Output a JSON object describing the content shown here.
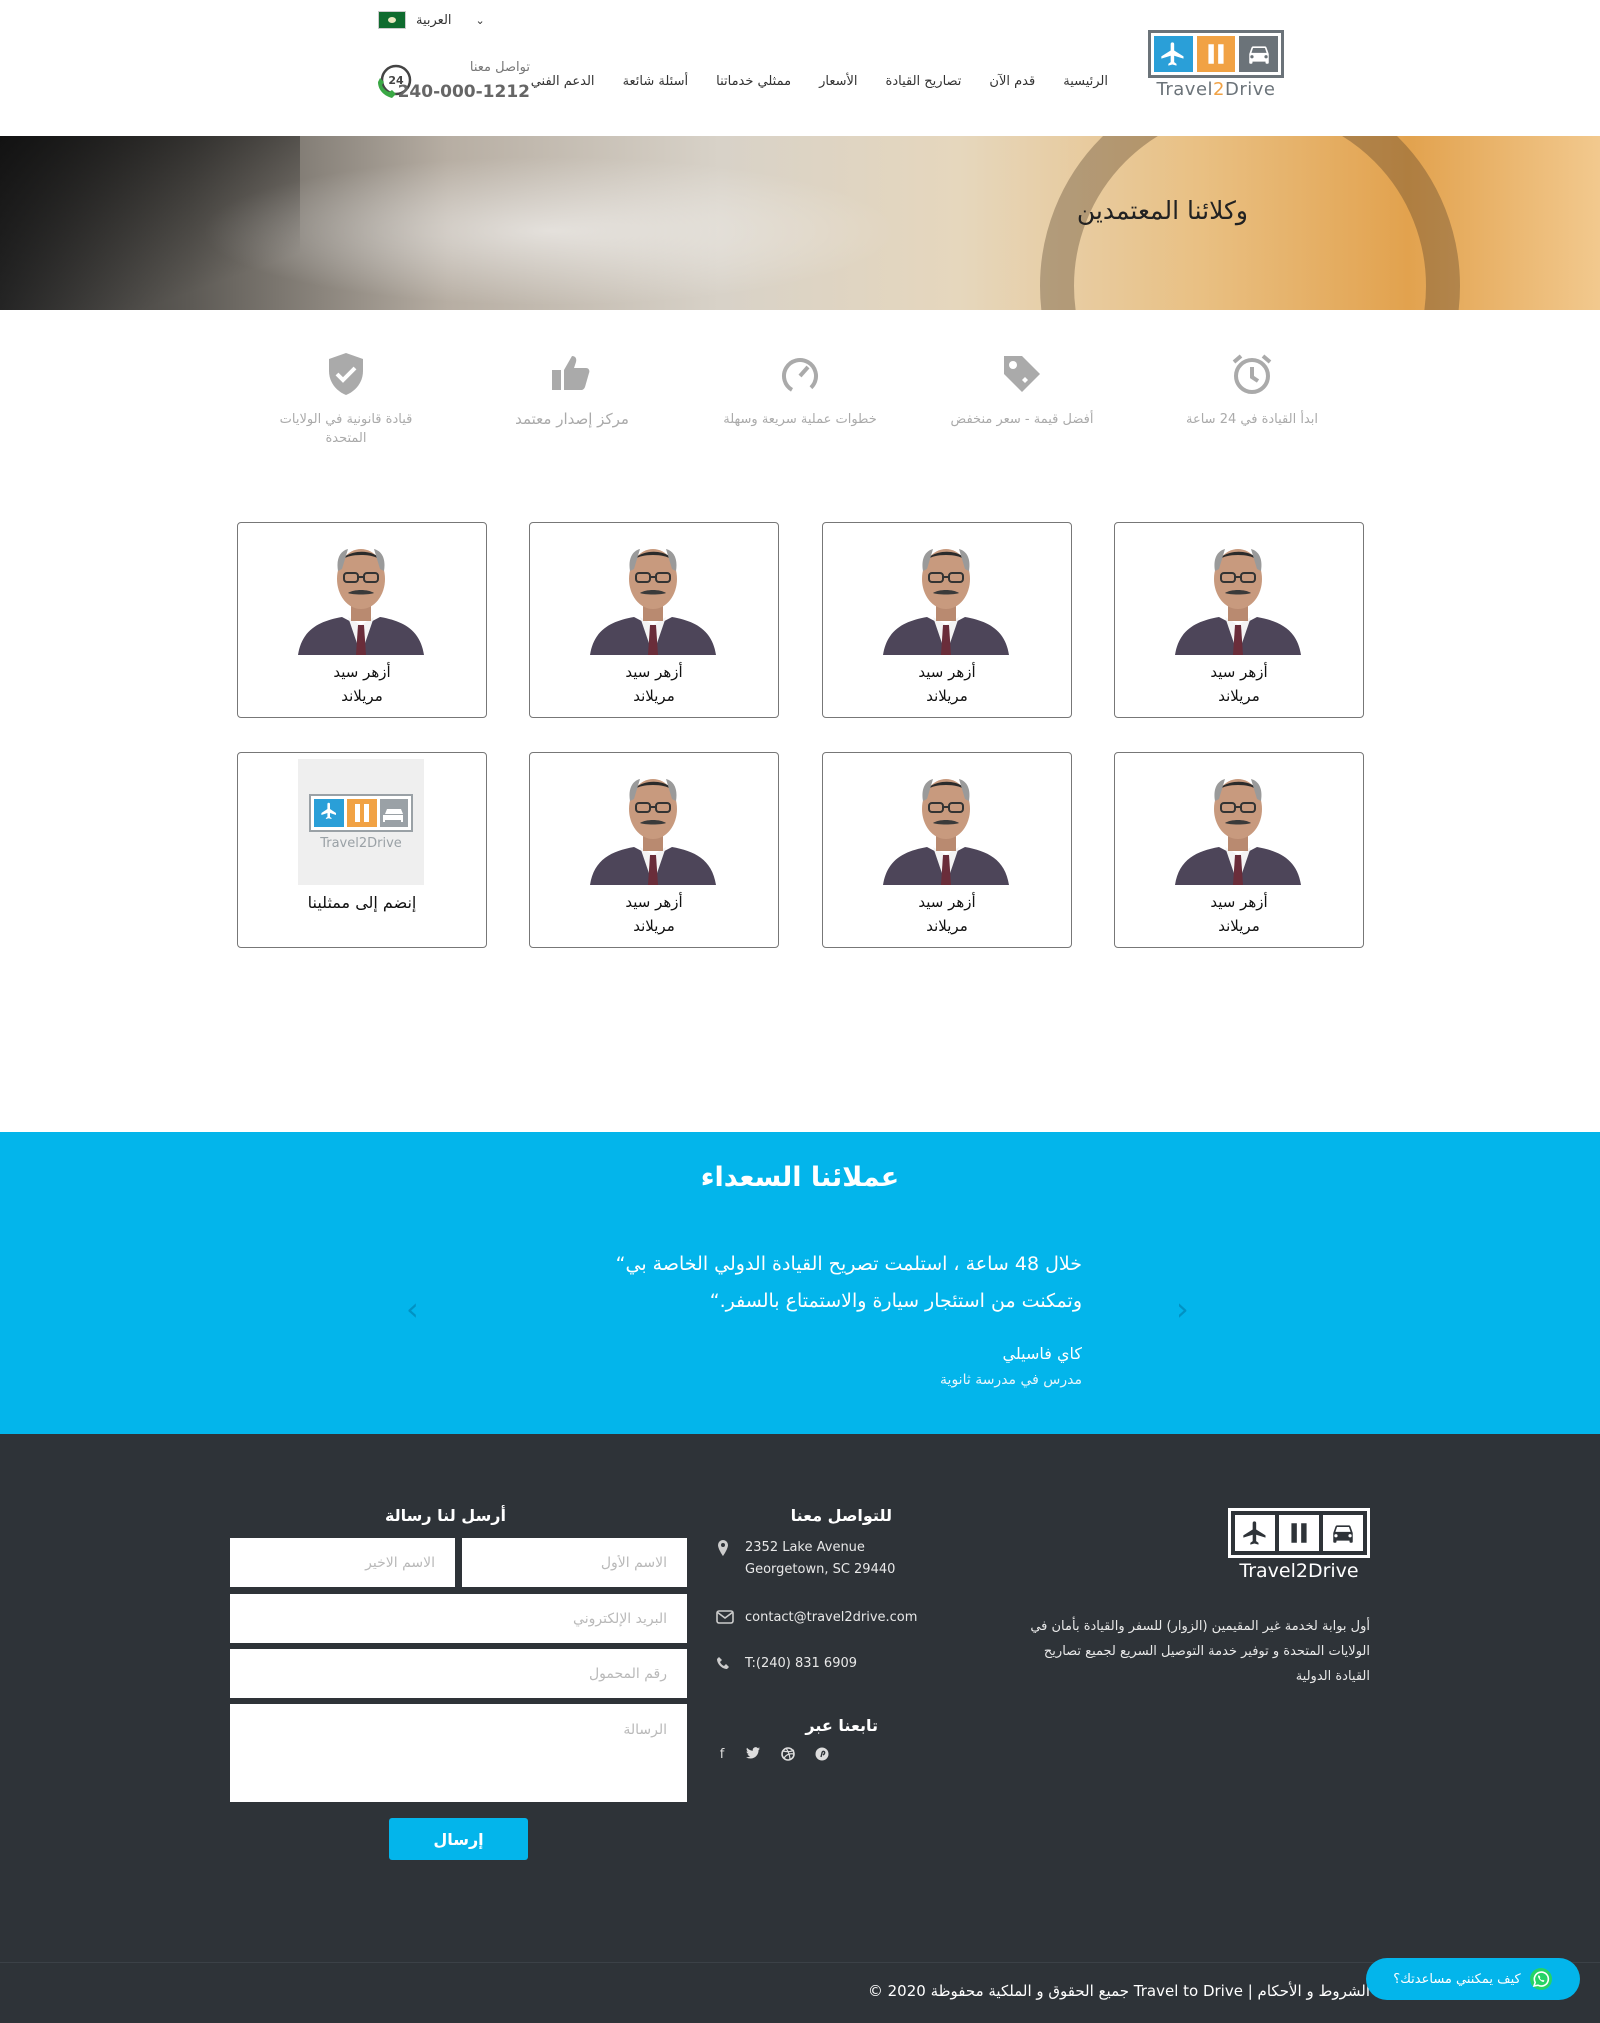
{
  "header": {
    "logo_text_a": "Travel",
    "logo_text_b": "2",
    "logo_text_c": "Drive",
    "nav": [
      "الرئيسية",
      "قدم الآن",
      "تصاريح القيادة",
      "الأسعار",
      "ممثلي خدماتنا",
      "أسئلة شائعة",
      "الدعم الفني"
    ],
    "language": "العربية",
    "contact_label": "تواصل معنا",
    "phone": "240-000-1212",
    "phone_badge": "24"
  },
  "banner": {
    "title": "وكلائنا المعتمدين"
  },
  "features": [
    {
      "icon": "alarm-clock-icon",
      "text": "ابدأ القيادة في 24 ساعة"
    },
    {
      "icon": "price-tag-icon",
      "text": "أفضل قيمة - سعر منخفض"
    },
    {
      "icon": "speedometer-icon",
      "text": "خطوات عملية سريعة وسهلة"
    },
    {
      "icon": "thumbs-up-icon",
      "text": "مركز إصدار معتمد"
    },
    {
      "icon": "shield-check-icon",
      "text": "قيادة قانونية في الولايات المتحدة"
    }
  ],
  "agents": [
    {
      "name": "أزهر سيد",
      "location": "مريلاند"
    },
    {
      "name": "أزهر سيد",
      "location": "مريلاند"
    },
    {
      "name": "أزهر سيد",
      "location": "مريلاند"
    },
    {
      "name": "أزهر سيد",
      "location": "مريلاند"
    },
    {
      "name": "أزهر سيد",
      "location": "مريلاند"
    },
    {
      "name": "أزهر سيد",
      "location": "مريلاند"
    },
    {
      "name": "أزهر سيد",
      "location": "مريلاند"
    }
  ],
  "join_card": {
    "label": "إنضم إلى ممثلينا",
    "logo_text": "Travel2Drive"
  },
  "testimonials": {
    "title": "عملائنا السعداء",
    "quote_line1": "خلال 48 ساعة ، استلمت تصريح القيادة الدولي الخاصة بي“",
    "quote_line2": "وتمكنت من استئجار سيارة والاستمتاع بالسفر.“",
    "author": "كاي فاسيلي",
    "role": "مدرس في مدرسة ثانوية",
    "prev": "‹",
    "next": "›"
  },
  "footer": {
    "logo_text": "Travel2Drive",
    "about": "أول بوابة لخدمة غير المقيمين (الزوار) للسفر والقيادة بأمان في الولايات المتحدة و توفير خدمة التوصيل السريع لجميع تصاريح القيادة الدولية",
    "contact_title": "للتواصل معنا",
    "address_line1": "2352 Lake Avenue",
    "address_line2": "Georgetown, SC 29440",
    "email": "contact@travel2drive.com",
    "phone": "T:(240) 831 6909",
    "follow_title": "تابعنا عبر",
    "form_title": "أرسل لنا رسالة",
    "form": {
      "first_name": "الاسم الأول",
      "last_name": "الاسم الاخير",
      "email": "البريد الإلكتروني",
      "mobile": "رقم المحمول",
      "message": "الرسالة",
      "send": "إرسال"
    },
    "copyright": "الشروط و الأحكام | Travel to Drive جميع الحقوق و الملكية محفوظة 2020 ©",
    "whatsapp": "كيف يمكنني مساعدتك؟"
  },
  "colors": {
    "accent": "#03b5eb",
    "footer_bg": "#2e3338",
    "logo_blue": "#2a9fd8",
    "logo_orange": "#f1a244",
    "logo_gray": "#6b7379",
    "whatsapp_green": "#25d366"
  }
}
